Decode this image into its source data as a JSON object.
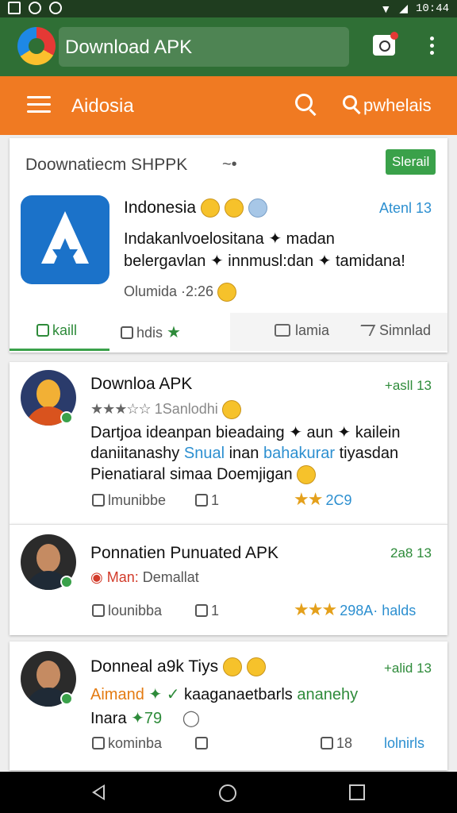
{
  "status_bar": {
    "time": "10:44"
  },
  "top_bar": {
    "url_text": "Download APK"
  },
  "search_bar": {
    "title": "Aidosia",
    "right_text": "pwhelais"
  },
  "featured": {
    "header": "Doownatiecm SHPPK",
    "start_button": "Slerail",
    "app_name": "Indonesia",
    "date": "Atenl 13",
    "desc_line1": "Indakanlvoelositana ✦ madan",
    "desc_line2": "belergavlan ✦ innmusl:dan ✦ tamidana!",
    "meta": "Olumida  ·2:26",
    "actions": {
      "like": "kaill",
      "huis": "hdis",
      "comment": "lamia",
      "share": "Simnlad"
    }
  },
  "posts": [
    {
      "title": "Downloa APK",
      "date": "+asll 13",
      "rating_text": "1Sanlodhi",
      "line1": "Dartjoa ideanpan bieadaing ✦ aun ✦ kailein",
      "line2_a": "daniitanashy",
      "line2_b": "Snual",
      "line2_c": "inan",
      "line2_d": "bahakurar",
      "line2_e": "tiyasdan",
      "line3": "Pienatiaral simaa Doemjigan",
      "like": "lmunibbe",
      "count": "1",
      "right": "2C9"
    },
    {
      "title": "Ponnatien Punuated APK",
      "date": "2a8 13",
      "sub_a": "Man:",
      "sub_b": "Demallat",
      "like": "lounibba",
      "count": "1",
      "right": "298A· halds"
    },
    {
      "title": "Donneal a9k Tiys",
      "date": "+alid 13",
      "line1_a": "Aimand",
      "line1_b": "kaaganaetbarls",
      "line1_c": "ananehy",
      "line2": "Inara",
      "line2_num": "79",
      "like": "kominba",
      "count": "18",
      "right": "lolnirls"
    }
  ],
  "colors": {
    "green_bar": "#2f6f35",
    "orange_bar": "#f07a22",
    "accent_green": "#3aa14a",
    "accent_blue": "#2c8fd0"
  }
}
